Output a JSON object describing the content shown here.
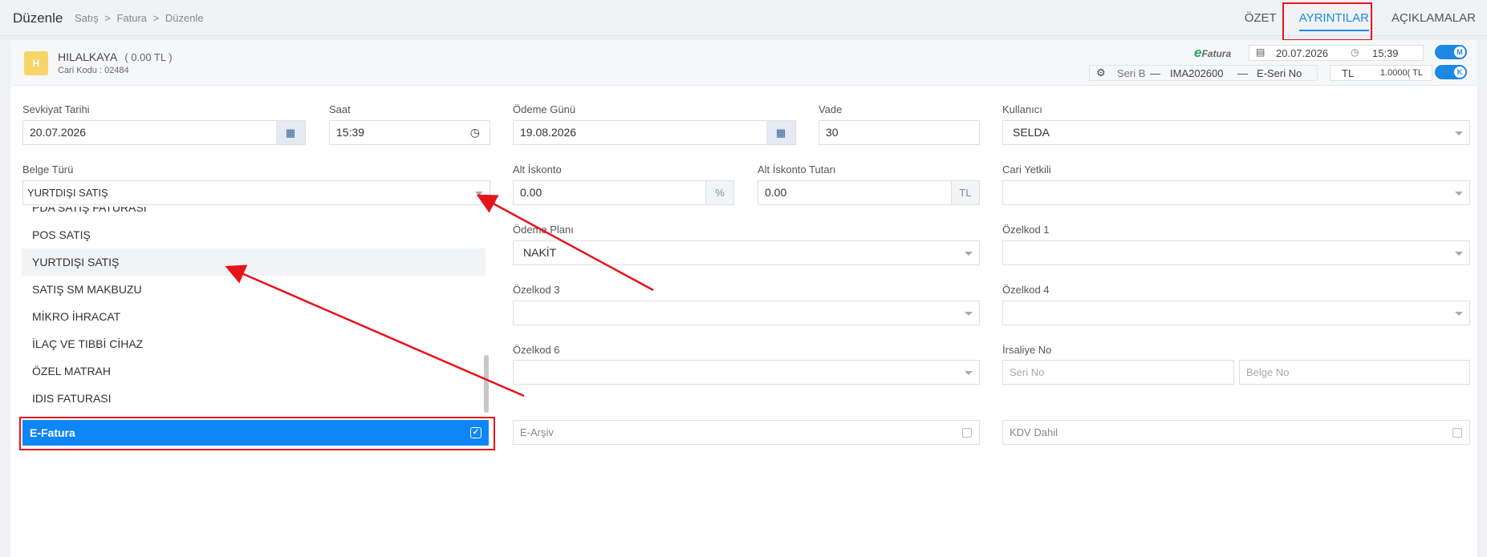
{
  "header": {
    "title": "Düzenle",
    "breadcrumb": [
      "Satış",
      ">",
      "Fatura",
      ">",
      "Düzenle"
    ],
    "tabs": [
      "ÖZET",
      "AYRINTILAR",
      "AÇIKLAMALAR"
    ]
  },
  "customer": {
    "avatar_letter": "H",
    "name": "HILALKAYA",
    "balance": "( 0.00 TL )",
    "code": "Cari Kodu : 02484"
  },
  "doc_info": {
    "efatura_logo_letter": "e",
    "efatura_logo_text": "Fatura",
    "date": "20.07.2026",
    "time": "15:39",
    "seri": "Seri B",
    "dash": "—",
    "doc_no": "IMA202600",
    "eseri": "E-Seri No",
    "currency": "TL",
    "rate": "1.0000( TL",
    "toggle_m": "M",
    "toggle_k": "K"
  },
  "form": {
    "sevkiyat_label": "Sevkiyat Tarihi",
    "sevkiyat_value": "20.07.2026",
    "saat_label": "Saat",
    "saat_value": "15:39",
    "odeme_gunu_label": "Ödeme Günü",
    "odeme_gunu_value": "19.08.2026",
    "vade_label": "Vade",
    "vade_value": "30",
    "kullanici_label": "Kullanıcı",
    "kullanici_value": "SELDA",
    "belge_turu_label": "Belge Türü",
    "belge_turu_value": "YURTDIŞI SATIŞ",
    "alt_iskonto_label": "Alt İskonto",
    "alt_iskonto_value": "0.00",
    "alt_iskonto_unit": "%",
    "alt_iskonto_tutari_label": "Alt İskonto Tutarı",
    "alt_iskonto_tutari_value": "0.00",
    "alt_iskonto_tutari_unit": "TL",
    "cari_yetkili_label": "Cari Yetkili",
    "odeme_plani_label": "Ödeme Planı",
    "odeme_plani_value": "NAKİT",
    "ozelkod1_label": "Özelkod 1",
    "ozelkod3_label": "Özelkod 3",
    "ozelkod4_label": "Özelkod 4",
    "ozelkod6_label": "Özelkod 6",
    "irsaliye_label": "İrsaliye No",
    "irsaliye_seri_placeholder": "Seri No",
    "irsaliye_belge_placeholder": "Belge No",
    "efatura_label": "E-Fatura",
    "earsiv_label": "E-Arşiv",
    "kdv_dahil_label": "KDV Dahil"
  },
  "dropdown": {
    "items": [
      "PDA SATIŞ FATURASI",
      "POS SATIŞ",
      "YURTDIŞI SATIŞ",
      "SATIŞ SM MAKBUZU",
      "MİKRO İHRACAT",
      "İLAÇ VE TIBBİ CİHAZ",
      "ÖZEL MATRAH",
      "IDIS FATURASI"
    ],
    "highlighted": "YURTDIŞI SATIŞ"
  },
  "icons": {
    "calendar": "calendar-icon",
    "clock": "clock-icon",
    "gear": "gear-icon",
    "check": "check-icon"
  },
  "colors": {
    "accent": "#1e88e5",
    "selected_row": "#0d86f7",
    "annotation": "#e8131a"
  }
}
